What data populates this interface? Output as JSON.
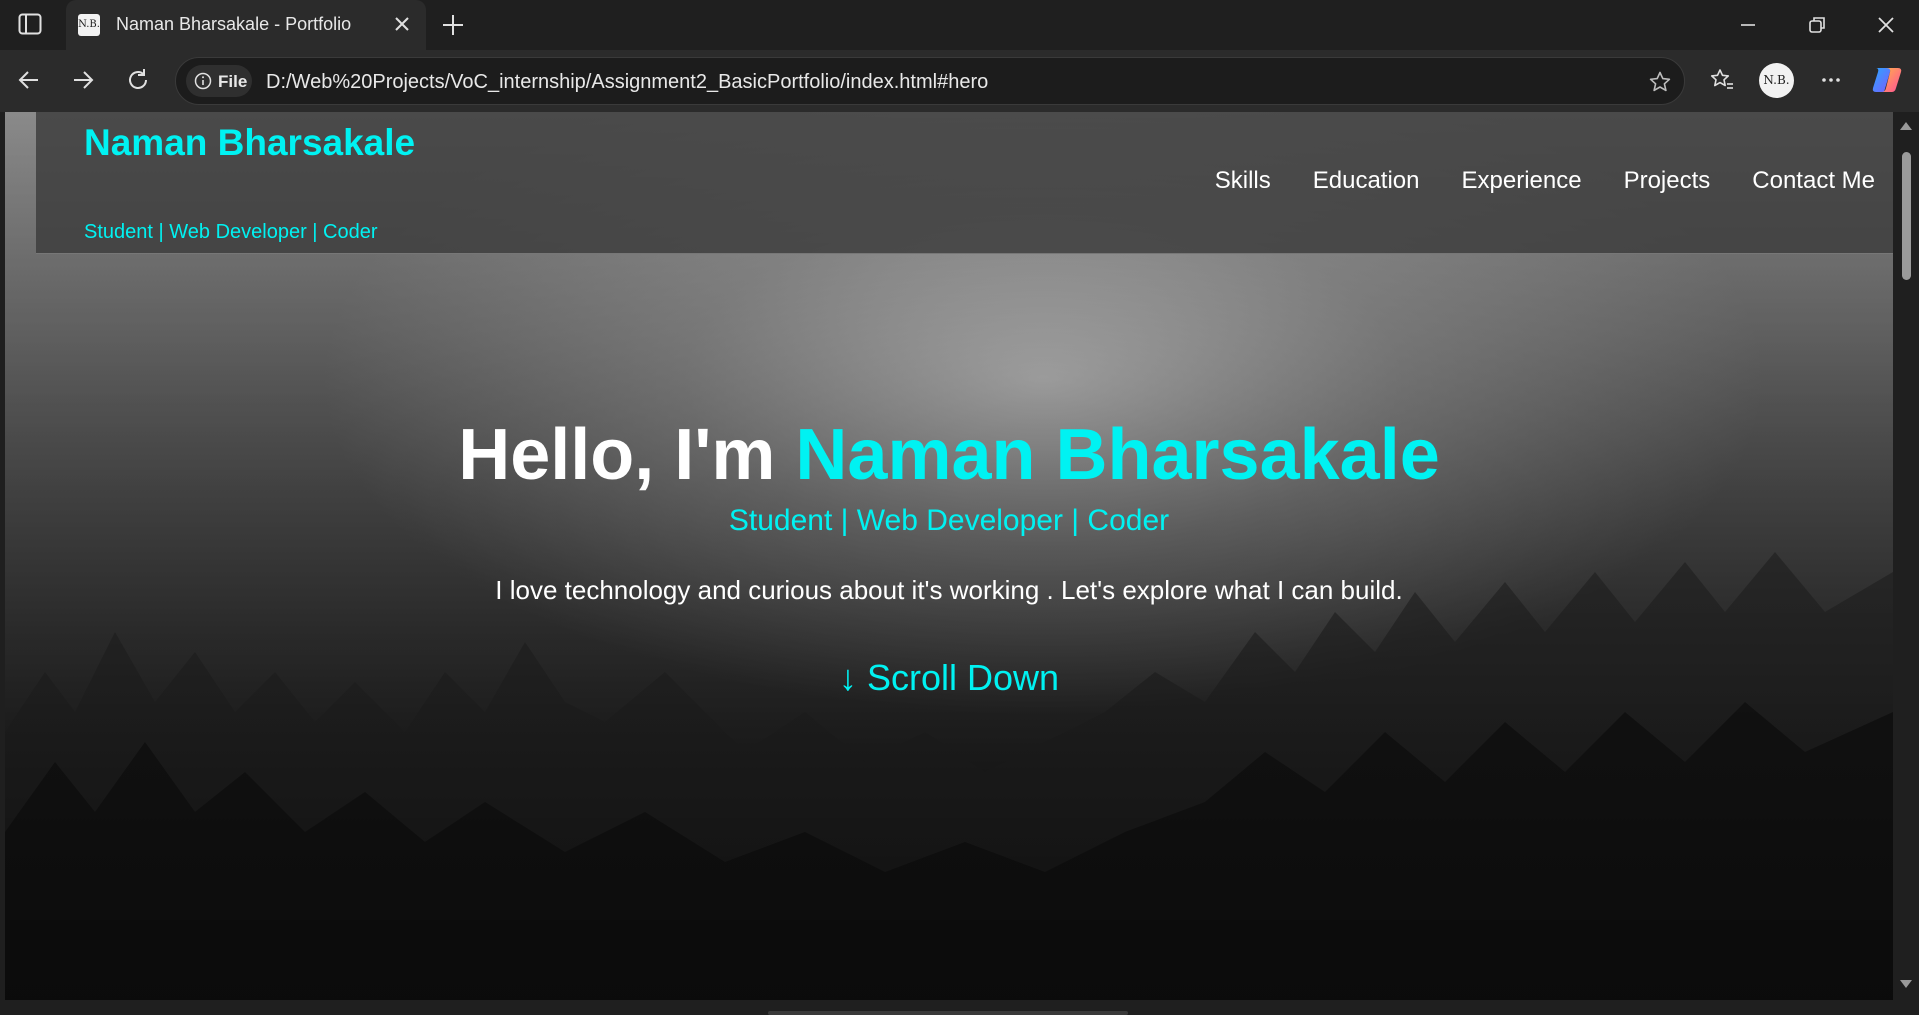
{
  "browser": {
    "tab_title": "Naman Bharsakale - Portfolio",
    "favicon_text": "N.B.",
    "site_info_label": "File",
    "url": "D:/Web%20Projects/VoC_internship/Assignment2_BasicPortfolio/index.html#hero",
    "profile_initials": "N.B."
  },
  "header": {
    "brand_name": "Naman Bharsakale",
    "brand_tagline": "Student | Web Developer | Coder",
    "nav": [
      "Skills",
      "Education",
      "Experience",
      "Projects",
      "Contact Me"
    ]
  },
  "hero": {
    "title_prefix": "Hello, I'm ",
    "title_name": "Naman Bharsakale",
    "subtitle": "Student | Web Developer | Coder",
    "description": "I love technology and curious about it's working . Let's explore what I can build.",
    "scroll_label": "↓ Scroll Down"
  },
  "colors": {
    "accent": "#00f2f2",
    "browser_bg": "#1f1f1f"
  }
}
